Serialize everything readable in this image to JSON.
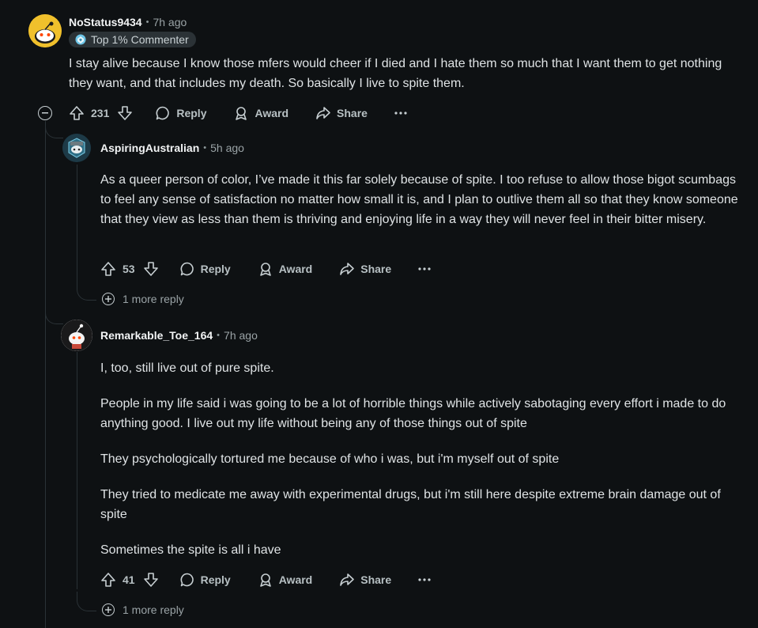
{
  "comments": [
    {
      "username": "NoStatus9434",
      "time": "7h ago",
      "badge": "Top 1% Commenter",
      "paragraphs": [
        "I stay alive because I know those mfers would cheer if I died and I hate them so much that I want them to get nothing they want, and that includes my death. So basically I live to spite them."
      ],
      "score": "231",
      "reply_label": "Reply",
      "award_label": "Award",
      "share_label": "Share"
    },
    {
      "username": "AspiringAustralian",
      "time": "5h ago",
      "paragraphs": [
        "As a queer person of color, I’ve made it this far solely because of spite. I too refuse to allow those bigot scumbags to feel any sense of satisfaction no matter how small it is, and I plan to outlive them all so that they know someone that they view as less than them is thriving and enjoying life in a way they will never feel in their bitter misery."
      ],
      "score": "53",
      "reply_label": "Reply",
      "award_label": "Award",
      "share_label": "Share",
      "more_replies": "1 more reply"
    },
    {
      "username": "Remarkable_Toe_164",
      "time": "7h ago",
      "paragraphs": [
        "I, too, still live out of pure spite.",
        "People in my life said i was going to be a lot of horrible things while actively sabotaging every effort i made to do anything good. I live out my life without being any of those things out of spite",
        "They psychologically tortured me because of who i was, but i'm myself out of spite",
        "They tried to medicate me away with experimental drugs, but i'm still here despite extreme brain damage out of spite",
        "Sometimes the spite is all i have"
      ],
      "score": "41",
      "reply_label": "Reply",
      "award_label": "Award",
      "share_label": "Share",
      "more_replies": "1 more reply"
    }
  ],
  "colors": {
    "background": "#0e1113",
    "text": "#dfe3e5",
    "muted": "#9aa3a6",
    "thread_line": "#2a3236"
  },
  "icons": [
    "snoo-avatar",
    "upvote-icon",
    "downvote-icon",
    "reply-bubble-icon",
    "award-icon",
    "share-icon",
    "more-dots-icon",
    "collapse-icon",
    "expand-icon",
    "badge-icon"
  ]
}
